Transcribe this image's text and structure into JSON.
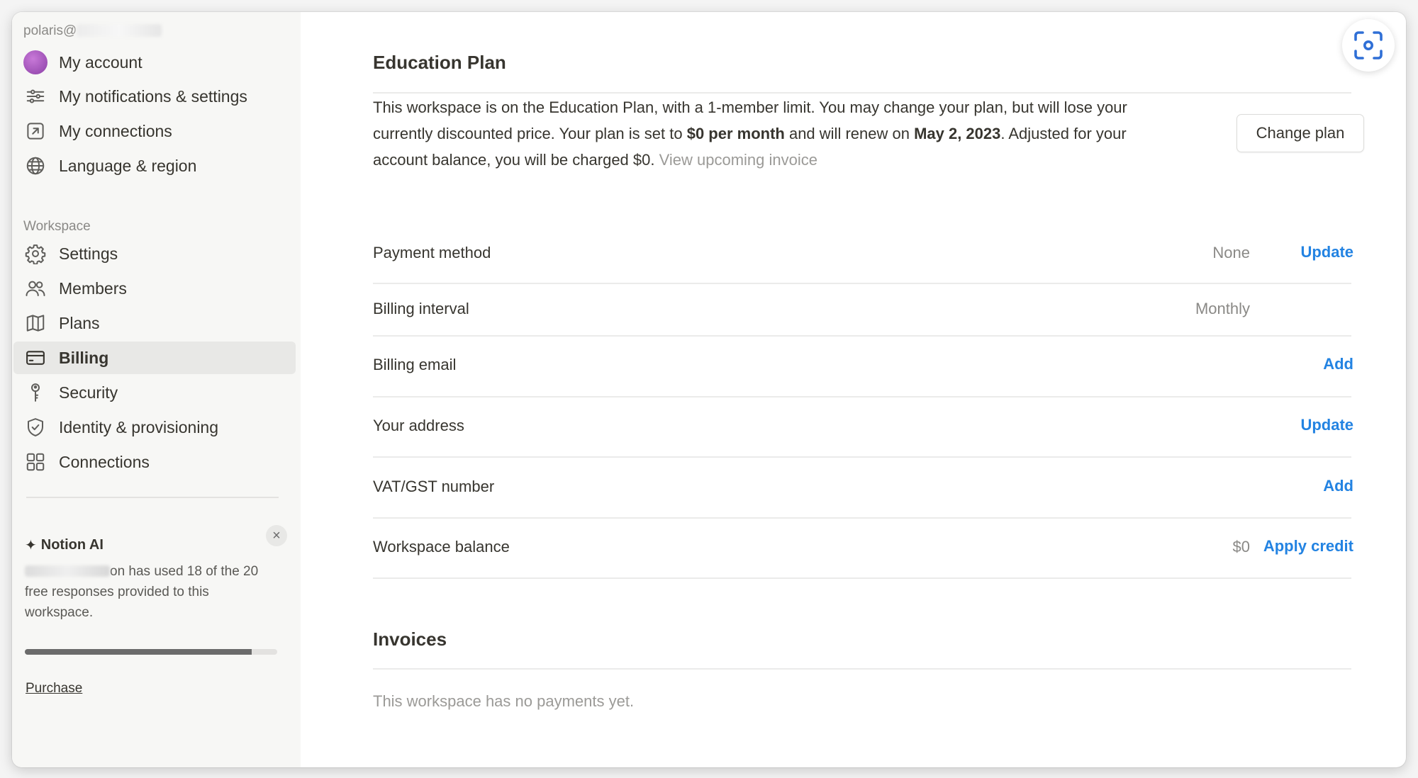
{
  "sidebar": {
    "account_email": "polaris@",
    "account_items": [
      {
        "label": "My account",
        "icon": "avatar"
      },
      {
        "label": "My notifications & settings",
        "icon": "sliders-icon"
      },
      {
        "label": "My connections",
        "icon": "external-link-icon"
      },
      {
        "label": "Language & region",
        "icon": "globe-icon"
      }
    ],
    "workspace_label": "Workspace",
    "workspace_items": [
      {
        "label": "Settings",
        "icon": "gear-icon"
      },
      {
        "label": "Members",
        "icon": "members-icon"
      },
      {
        "label": "Plans",
        "icon": "map-icon"
      },
      {
        "label": "Billing",
        "icon": "credit-card-icon",
        "active": true
      },
      {
        "label": "Security",
        "icon": "key-icon"
      },
      {
        "label": "Identity & provisioning",
        "icon": "shield-check-icon"
      },
      {
        "label": "Connections",
        "icon": "grid-icon"
      }
    ],
    "ai_card": {
      "title": "Notion AI",
      "text": "on has used 18 of the 20 free responses provided to this workspace.",
      "used": 18,
      "total": 20,
      "purchase_label": "Purchase"
    }
  },
  "main": {
    "plan_title": "Education Plan",
    "plan_desc": {
      "part1": "This workspace is on the Education Plan, with a 1-member limit. You may change your plan, but will lose your currently discounted price. Your plan is set to ",
      "price": "$0 per month",
      "part2": " and will renew on ",
      "renew_date": "May 2, 2023",
      "part3": ". Adjusted for your account balance, you will be charged $0. ",
      "invoice_link": "View upcoming invoice"
    },
    "change_plan_label": "Change plan",
    "billing_rows": [
      {
        "label": "Payment method",
        "value": "None",
        "action": "Update"
      },
      {
        "label": "Billing interval",
        "value": "Monthly",
        "action": ""
      },
      {
        "label": "Billing email",
        "value": "",
        "action": "Add"
      },
      {
        "label": "Your address",
        "value": "",
        "action": "Update"
      },
      {
        "label": "VAT/GST number",
        "value": "",
        "action": "Add"
      },
      {
        "label": "Workspace balance",
        "value": "$0",
        "action": "Apply credit"
      }
    ],
    "invoices_title": "Invoices",
    "invoices_empty": "This workspace has no payments yet."
  },
  "colors": {
    "accent": "#2383e2",
    "sidebar_bg": "#f7f7f5",
    "active_item_bg": "#e8e8e6",
    "text": "#37352f",
    "muted": "#8a8986"
  }
}
